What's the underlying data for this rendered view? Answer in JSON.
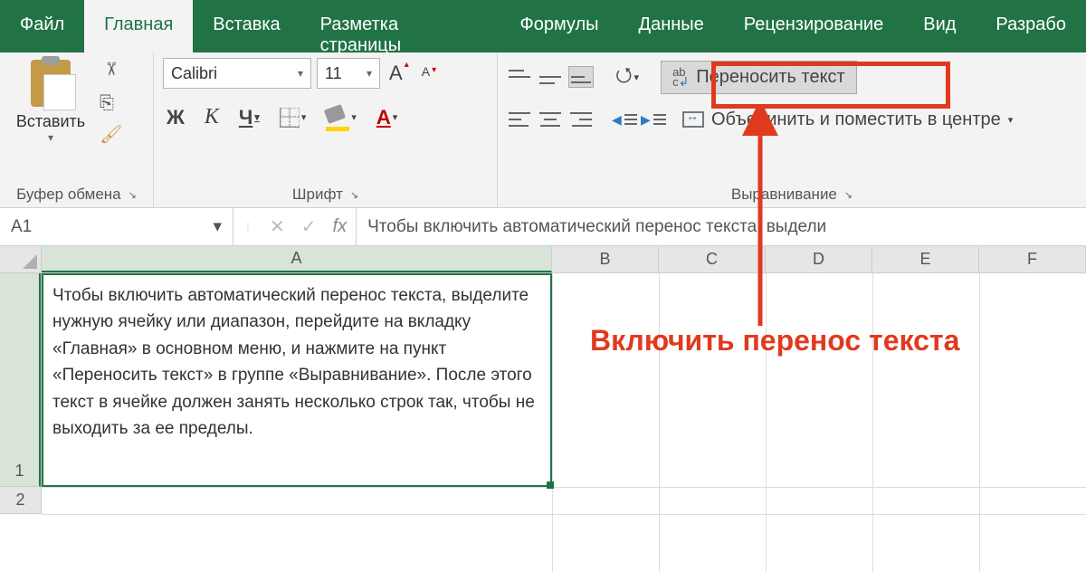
{
  "tabs": {
    "file": "Файл",
    "home": "Главная",
    "insert": "Вставка",
    "layout": "Разметка страницы",
    "formulas": "Формулы",
    "data": "Данные",
    "review": "Рецензирование",
    "view": "Вид",
    "dev": "Разрабо"
  },
  "clipboard": {
    "paste": "Вставить",
    "title": "Буфер обмена"
  },
  "font": {
    "name": "Calibri",
    "size": "11",
    "bold": "Ж",
    "italic": "К",
    "underline": "Ч",
    "color_letter": "А",
    "bigA": "А",
    "smallA": "А",
    "title": "Шрифт"
  },
  "align": {
    "wrap": "Переносить текст",
    "merge": "Объединить и поместить в центре",
    "title": "Выравнивание"
  },
  "fbar": {
    "cellref": "A1",
    "fx": "fx",
    "text": "Чтобы включить автоматический перенос текста, выдели"
  },
  "columns": [
    "A",
    "B",
    "C",
    "D",
    "E",
    "F"
  ],
  "rows": [
    "1",
    "2"
  ],
  "cellA1": "Чтобы включить автоматический перенос текста, выделите нужную ячейку или диапазон, перейдите на вкладку «Главная» в основном меню, и нажмите на пункт «Переносить текст» в группе «Выравнивание». После этого текст в ячейке должен занять несколько строк так, чтобы не выходить за ее пределы.",
  "annotation": "Включить перенос текста",
  "glyphs": {
    "dd": "▾",
    "cut": "✂",
    "copy": "⎘",
    "brush": "🖌",
    "launch": "↘",
    "cancel": "✕",
    "ok": "✓",
    "orient_arrow": "⭯"
  }
}
